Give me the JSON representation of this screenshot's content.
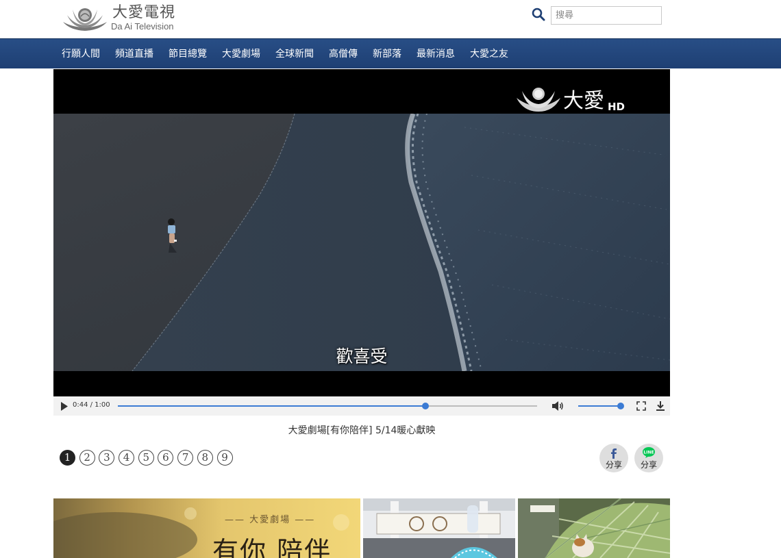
{
  "header": {
    "logo_cn": "大愛電視",
    "logo_en": "Da Ai Television",
    "search_placeholder": "搜尋"
  },
  "nav": {
    "items": [
      "行願人間",
      "頻道直播",
      "節目總覽",
      "大愛劇場",
      "全球新聞",
      "高僧傳",
      "新部落",
      "最新消息",
      "大愛之友"
    ]
  },
  "player": {
    "channel_logo_text": "大愛",
    "channel_logo_hd": "HD",
    "subtitle": "歡喜受",
    "time": "0:44 / 1:00",
    "progress_fraction": 0.733,
    "volume_fraction": 1.0
  },
  "video_title": "大愛劇場[有你陪伴] 5/14暖心獻映",
  "pager": {
    "pages": [
      "1",
      "2",
      "3",
      "4",
      "5",
      "6",
      "7",
      "8",
      "9"
    ],
    "active_index": 0
  },
  "share": {
    "facebook_label": "分享",
    "line_label": "分享",
    "line_badge": "LINE"
  },
  "thumbnails": {
    "first_label": "—— 大愛劇場 ——",
    "first_title": "有你 陪伴"
  },
  "colors": {
    "nav_bg": "#244a80",
    "accent": "#3b7bd4",
    "line_green": "#06c755",
    "facebook_blue": "#3b5998"
  }
}
